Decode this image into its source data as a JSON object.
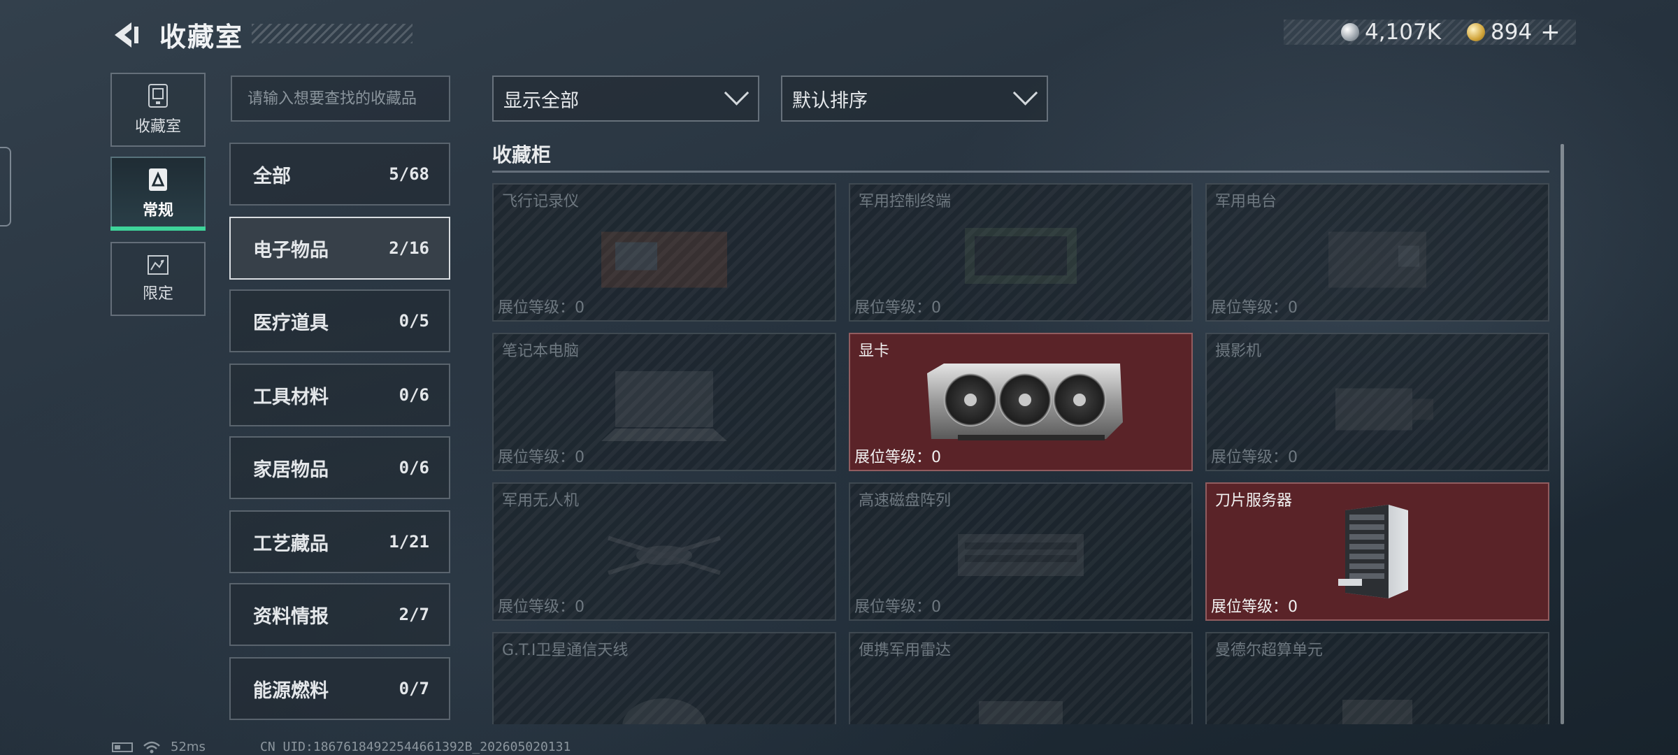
{
  "header": {
    "title": "收藏室"
  },
  "currency": [
    {
      "icon": "silver-coin-icon",
      "value": "4,107K"
    },
    {
      "icon": "gold-coin-icon",
      "value": "894"
    }
  ],
  "plus_label": "+",
  "side_tabs": [
    {
      "label": "收藏室",
      "icon": "display-case-icon",
      "active": false
    },
    {
      "label": "常规",
      "icon": "collection-doc-icon",
      "active": true
    },
    {
      "label": "限定",
      "icon": "limited-icon",
      "active": false
    }
  ],
  "search": {
    "placeholder": "请输入想要查找的收藏品"
  },
  "categories": [
    {
      "name": "全部",
      "count": "5/68"
    },
    {
      "name": "电子物品",
      "count": "2/16",
      "active": true
    },
    {
      "name": "医疗道具",
      "count": "0/5"
    },
    {
      "name": "工具材料",
      "count": "0/6"
    },
    {
      "name": "家居物品",
      "count": "0/6"
    },
    {
      "name": "工艺藏品",
      "count": "1/21"
    },
    {
      "name": "资料情报",
      "count": "2/7"
    },
    {
      "name": "能源燃料",
      "count": "0/7"
    }
  ],
  "filters": {
    "show": "显示全部",
    "sort": "默认排序"
  },
  "section": {
    "title": "收藏柜"
  },
  "cabinet": [
    {
      "name": "飞行记录仪",
      "level": "展位等级：0",
      "owned": false
    },
    {
      "name": "军用控制终端",
      "level": "展位等级：0",
      "owned": false
    },
    {
      "name": "军用电台",
      "level": "展位等级：0",
      "owned": false
    },
    {
      "name": "笔记本电脑",
      "level": "展位等级：0",
      "owned": false
    },
    {
      "name": "显卡",
      "level": "展位等级：0",
      "owned": true
    },
    {
      "name": "摄影机",
      "level": "展位等级：0",
      "owned": false
    },
    {
      "name": "军用无人机",
      "level": "展位等级：0",
      "owned": false
    },
    {
      "name": "高速磁盘阵列",
      "level": "展位等级：0",
      "owned": false
    },
    {
      "name": "刀片服务器",
      "level": "展位等级：0",
      "owned": true
    },
    {
      "name": "G.T.I卫星通信天线",
      "level": "",
      "owned": false
    },
    {
      "name": "便携军用雷达",
      "level": "",
      "owned": false
    },
    {
      "name": "曼德尔超算单元",
      "level": "",
      "owned": false
    }
  ],
  "status": {
    "ping": "52ms",
    "uid": "CN UID:18676184922544661392B_202605020131"
  },
  "colors": {
    "accent": "#3ed49a",
    "owned_card": "#5a2328"
  }
}
